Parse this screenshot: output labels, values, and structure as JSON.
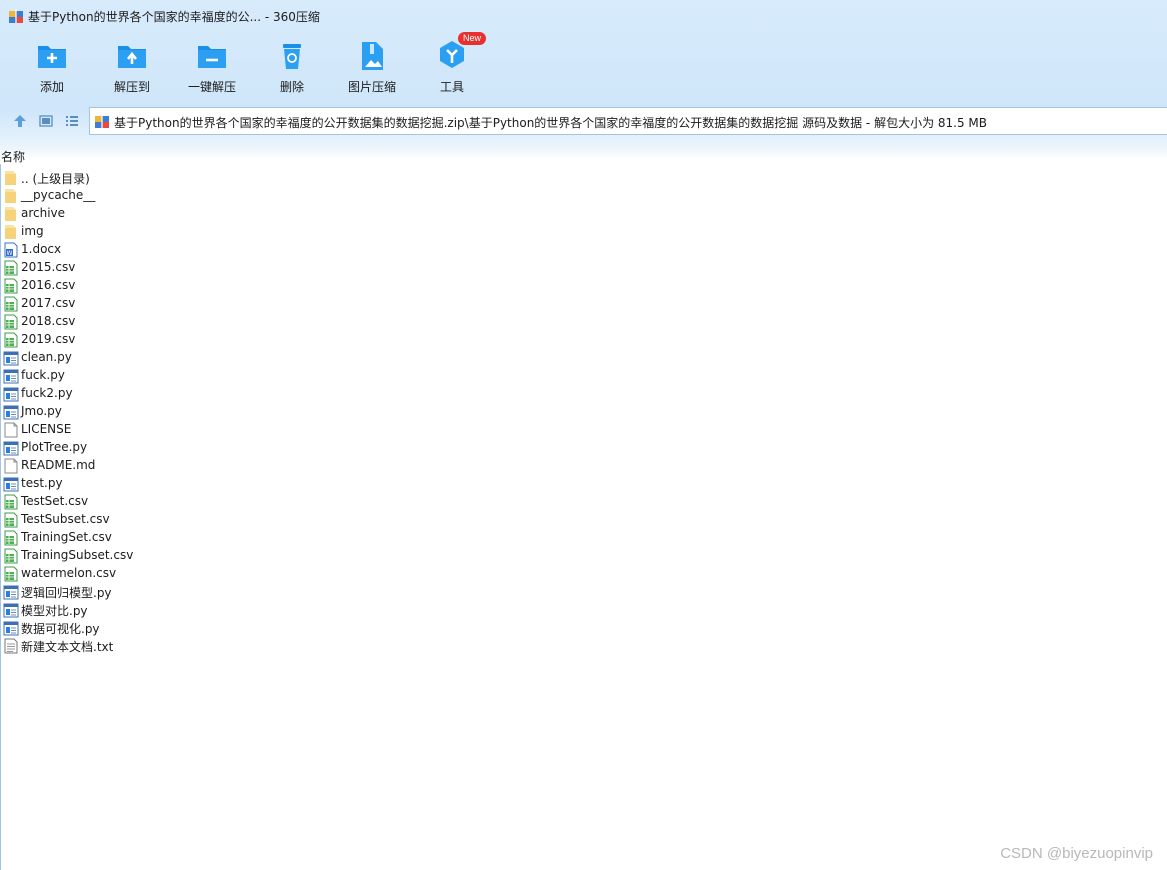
{
  "window": {
    "title": "基于Python的世界各个国家的幸福度的公... - 360压缩"
  },
  "toolbar": [
    {
      "label": "添加",
      "icon": "add-folder-icon"
    },
    {
      "label": "解压到",
      "icon": "extract-to-icon"
    },
    {
      "label": "一键解压",
      "icon": "one-click-extract-icon"
    },
    {
      "label": "删除",
      "icon": "delete-bin-icon"
    },
    {
      "label": "图片压缩",
      "icon": "image-compress-icon"
    },
    {
      "label": "工具",
      "icon": "tools-hexagon-icon",
      "badge": "New"
    }
  ],
  "path": {
    "text": "基于Python的世界各个国家的幸福度的公开数据集的数据挖掘.zip\\基于Python的世界各个国家的幸福度的公开数据集的数据挖掘 源码及数据 - 解包大小为 81.5 MB"
  },
  "list_header": {
    "name_column": "名称"
  },
  "files": [
    {
      "name": ".. (上级目录)",
      "type": "folder"
    },
    {
      "name": "__pycache__",
      "type": "folder"
    },
    {
      "name": "archive",
      "type": "folder"
    },
    {
      "name": "img",
      "type": "folder"
    },
    {
      "name": "1.docx",
      "type": "docx"
    },
    {
      "name": "2015.csv",
      "type": "csv"
    },
    {
      "name": "2016.csv",
      "type": "csv"
    },
    {
      "name": "2017.csv",
      "type": "csv"
    },
    {
      "name": "2018.csv",
      "type": "csv"
    },
    {
      "name": "2019.csv",
      "type": "csv"
    },
    {
      "name": "clean.py",
      "type": "py"
    },
    {
      "name": "fuck.py",
      "type": "py"
    },
    {
      "name": "fuck2.py",
      "type": "py"
    },
    {
      "name": "Jmo.py",
      "type": "py"
    },
    {
      "name": "LICENSE",
      "type": "blank"
    },
    {
      "name": "PlotTree.py",
      "type": "py"
    },
    {
      "name": "README.md",
      "type": "blank"
    },
    {
      "name": "test.py",
      "type": "py"
    },
    {
      "name": "TestSet.csv",
      "type": "csv"
    },
    {
      "name": "TestSubset.csv",
      "type": "csv"
    },
    {
      "name": "TrainingSet.csv",
      "type": "csv"
    },
    {
      "name": "TrainingSubset.csv",
      "type": "csv"
    },
    {
      "name": "watermelon.csv",
      "type": "csv"
    },
    {
      "name": "逻辑回归模型.py",
      "type": "py"
    },
    {
      "name": "模型对比.py",
      "type": "py"
    },
    {
      "name": "数据可视化.py",
      "type": "py"
    },
    {
      "name": "新建文本文档.txt",
      "type": "txt"
    }
  ],
  "watermark": "CSDN @biyezuopinvip"
}
